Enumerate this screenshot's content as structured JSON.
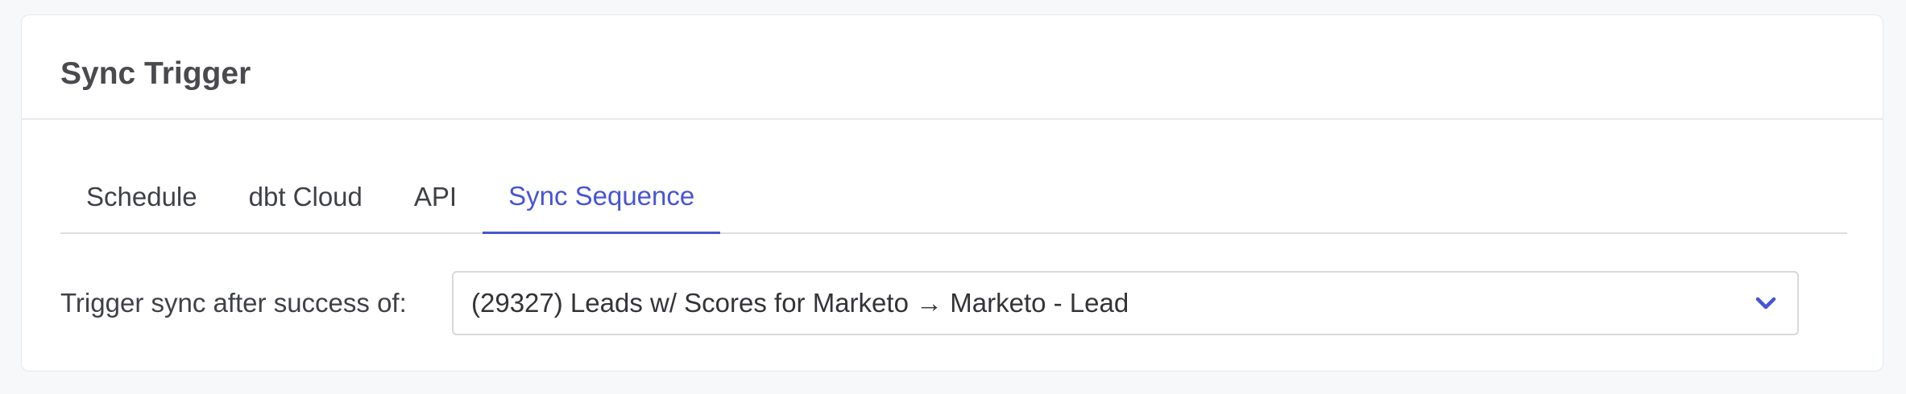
{
  "card": {
    "title": "Sync Trigger"
  },
  "tabs": [
    {
      "label": "Schedule",
      "active": false
    },
    {
      "label": "dbt Cloud",
      "active": false
    },
    {
      "label": "API",
      "active": false
    },
    {
      "label": "Sync Sequence",
      "active": true
    }
  ],
  "trigger": {
    "label": "Trigger sync after success of:",
    "selected_value": "(29327) Leads w/ Scores for Marketo → Marketo - Lead",
    "chevron_icon": "chevron-down-icon"
  },
  "colors": {
    "accent": "#4754d6",
    "text": "#3f4147",
    "border": "#d8d9dd",
    "background": "#f7f8fa"
  }
}
